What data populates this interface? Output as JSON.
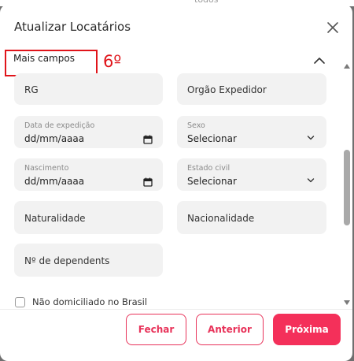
{
  "background": {
    "peek_text": "todos"
  },
  "modal": {
    "title": "Atualizar Locatários",
    "close_icon": "close-icon"
  },
  "section": {
    "title": "Mais campos",
    "annotation": "6º",
    "collapse_icon": "chevron-up-icon"
  },
  "fields": {
    "rg": {
      "placeholder": "RG"
    },
    "orgao_expedidor": {
      "placeholder": "Orgão Expedidor"
    },
    "data_expedicao": {
      "label": "Data de expedição",
      "value": "dd/mm/aaaa",
      "icon": "calendar-icon"
    },
    "sexo": {
      "label": "Sexo",
      "value": "Selecionar",
      "icon": "chevron-down-icon"
    },
    "nascimento": {
      "label": "Nascimento",
      "value": "dd/mm/aaaa",
      "icon": "calendar-icon"
    },
    "estado_civil": {
      "label": "Estado civil",
      "value": "Selecionar",
      "icon": "chevron-down-icon"
    },
    "naturalidade": {
      "placeholder": "Naturalidade"
    },
    "nacionalidade": {
      "placeholder": "Nacionalidade"
    },
    "dependentes": {
      "placeholder": "Nº de dependents"
    }
  },
  "checkbox": {
    "label": "Não domiciliado no Brasil",
    "checked": false
  },
  "footer": {
    "fechar": "Fechar",
    "anterior": "Anterior",
    "proxima": "Próxima"
  },
  "colors": {
    "accent": "#f4305a",
    "annotation_red": "#e0141a",
    "field_bg": "#f2f2f2"
  }
}
